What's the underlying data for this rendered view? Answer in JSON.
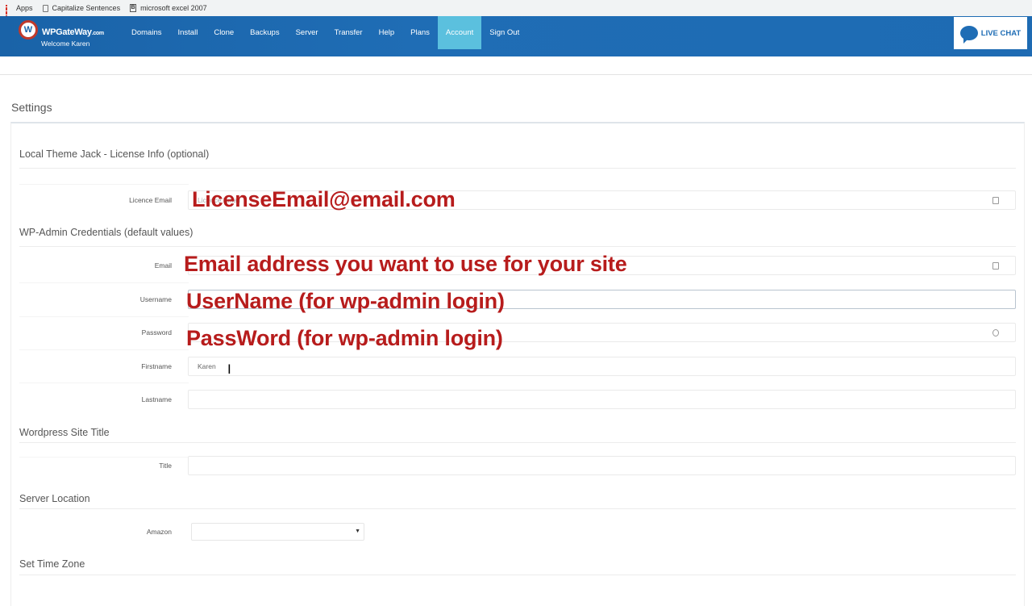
{
  "bookmarks": {
    "apps": "Apps",
    "item1": "Capitalize Sentences",
    "item2": "microsoft excel 2007"
  },
  "nav": {
    "brand": "WPGateWay",
    "brand_suffix": ".com",
    "welcome": "Welcome Karen",
    "links": [
      "Domains",
      "Install",
      "Clone",
      "Backups",
      "Server",
      "Transfer",
      "Help",
      "Plans",
      "Account",
      "Sign Out"
    ],
    "active": "Account",
    "live_chat": "LIVE CHAT"
  },
  "page": {
    "title": "Settings"
  },
  "sections": {
    "license": "Local Theme Jack - License Info (optional)",
    "wp_admin": "WP-Admin Credentials (default values)",
    "site_title": "Wordpress Site Title",
    "server_location": "Server Location",
    "time_zone": "Set Time Zone"
  },
  "fields": {
    "licence_email": {
      "label": "Licence Email",
      "placeholder": "Licence Email"
    },
    "email": {
      "label": "Email"
    },
    "username": {
      "label": "Username"
    },
    "password": {
      "label": "Password"
    },
    "firstname": {
      "label": "Firstname",
      "value": "Karen"
    },
    "lastname": {
      "label": "Lastname",
      "value": ""
    },
    "title": {
      "label": "Title",
      "value": ""
    },
    "amazon": {
      "label": "Amazon",
      "value": ""
    }
  },
  "overlays": {
    "licence_email": "LicenseEmail@email.com",
    "email": "Email address you want to use for your site",
    "username": "UserName (for wp-admin login)",
    "password": "PassWord (for wp-admin login)"
  },
  "colors": {
    "navbar": "#1f6db5",
    "active_tab": "#5bc0de",
    "overlay_text": "#b71c1c"
  }
}
